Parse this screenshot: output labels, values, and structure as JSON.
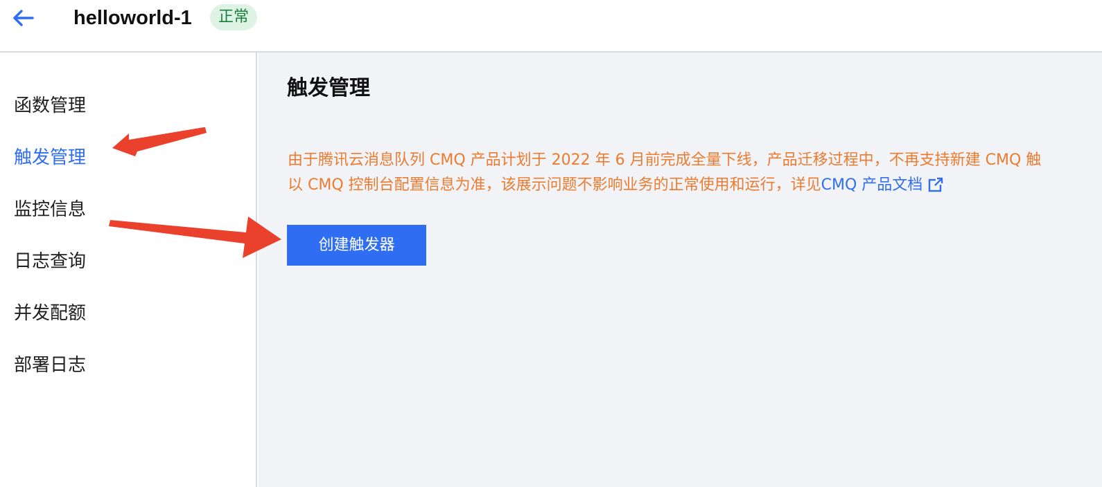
{
  "header": {
    "back_icon": "arrow-left-icon",
    "title": "helloworld-1",
    "status": "正常"
  },
  "sidebar": {
    "items": [
      {
        "label": "函数管理",
        "active": false
      },
      {
        "label": "触发管理",
        "active": true
      },
      {
        "label": "监控信息",
        "active": false
      },
      {
        "label": "日志查询",
        "active": false
      },
      {
        "label": "并发配额",
        "active": false
      },
      {
        "label": "部署日志",
        "active": false
      }
    ]
  },
  "main": {
    "title": "触发管理",
    "notice": {
      "line1": "由于腾讯云消息队列 CMQ 产品计划于 2022 年 6 月前完成全量下线，产品迁移过程中，不再支持新建 CMQ 触",
      "line2_prefix": "以 CMQ 控制台配置信息为准，该展示问题不影响业务的正常使用和运行，详见",
      "link": "CMQ 产品文档",
      "link_icon": "external-link-icon"
    },
    "create_button": "创建触发器"
  },
  "annotations": {
    "arrow_color": "#e9412b"
  },
  "colors": {
    "accent": "#2f6ef2",
    "warning": "#ed7b2f",
    "status_bg": "#dff3e4",
    "status_text": "#1a7f3c",
    "main_bg": "#f2f3f7"
  }
}
